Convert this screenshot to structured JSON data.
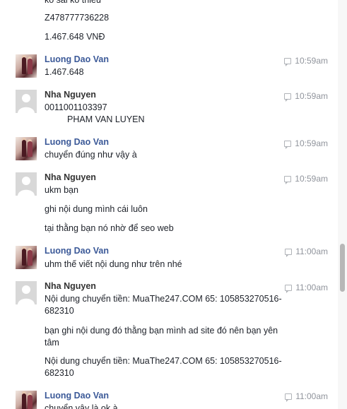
{
  "messages": [
    {
      "kind": "continuation",
      "lines": [
        "ko sai ko thiếu",
        "Z478777736228",
        "1.467.648 VNĐ"
      ]
    },
    {
      "author": "Luong Dao Van",
      "avatar": "photo-avatar",
      "time": "10:59am",
      "lines": [
        "1.467.648"
      ]
    },
    {
      "author": "Nha Nguyen",
      "avatar": "default-avatar",
      "time": "10:59am",
      "lines": [
        "0011001103397",
        "PHAM VAN LUYEN"
      ]
    },
    {
      "author": "Luong Dao Van",
      "avatar": "photo-avatar",
      "time": "10:59am",
      "lines": [
        "chuyển đúng như vậy à"
      ]
    },
    {
      "author": "Nha Nguyen",
      "avatar": "default-avatar",
      "time": "10:59am",
      "lines": [
        "ukm bạn",
        "ghi nội dung mình cái luôn",
        "tại thằng bạn nó nhờ để seo web"
      ]
    },
    {
      "author": "Luong Dao Van",
      "avatar": "photo-avatar",
      "time": "11:00am",
      "lines": [
        "uhm thế viết nội dung như trên nhé"
      ]
    },
    {
      "author": "Nha Nguyen",
      "avatar": "default-avatar",
      "time": "11:00am",
      "lines": [
        "Nội dung chuyển tiền: MuaThe247.COM 65: 105853270516-",
        "682310",
        "bạn ghi nội dung đó thằng bạn mình ad site đó nên bạn yên",
        "tâm",
        "Nội dung chuyển tiền: MuaThe247.COM 65: 105853270516-",
        "682310"
      ]
    },
    {
      "author": "Luong Dao Van",
      "avatar": "photo-avatar",
      "time": "11:00am",
      "lines": [
        "chuyển vậy là ok à"
      ]
    }
  ],
  "colors": {
    "author_link": "#3b5998",
    "author_plain": "#333333",
    "timestamp": "#90949c"
  },
  "icons": {
    "timestamp": "chat-bubble-icon"
  }
}
